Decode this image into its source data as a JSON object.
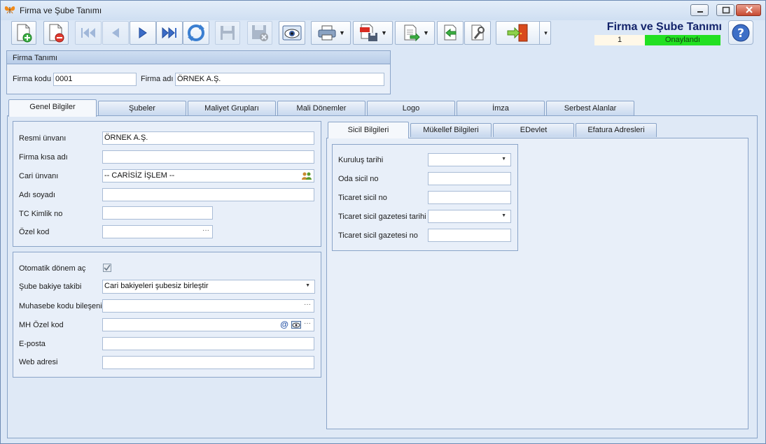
{
  "window": {
    "title": "Firma ve Şube Tanımı"
  },
  "header": {
    "title": "Firma ve Şube Tanımı",
    "record_number": "1",
    "status": "Onaylandı",
    "status_color": "#22e022",
    "brand_color": "#14246b"
  },
  "toolbar": {
    "buttons": [
      {
        "name": "new-record-icon",
        "disabled": false
      },
      {
        "name": "delete-record-icon",
        "disabled": false
      },
      {
        "name": "first-record-icon",
        "disabled": true
      },
      {
        "name": "previous-record-icon",
        "disabled": true
      },
      {
        "name": "next-record-icon",
        "disabled": false
      },
      {
        "name": "last-record-icon",
        "disabled": false
      },
      {
        "name": "refresh-icon",
        "disabled": false
      },
      {
        "name": "save-icon",
        "disabled": true
      },
      {
        "name": "save-cancel-icon",
        "disabled": true
      },
      {
        "name": "preview-icon",
        "disabled": false
      },
      {
        "name": "print-icon",
        "disabled": false
      },
      {
        "name": "pdf-export-icon",
        "disabled": false
      },
      {
        "name": "export-icon",
        "disabled": false
      },
      {
        "name": "import-icon",
        "disabled": false
      },
      {
        "name": "settings-icon",
        "disabled": false
      },
      {
        "name": "exit-icon",
        "disabled": false
      }
    ]
  },
  "firma_tanimi": {
    "title": "Firma Tanımı",
    "firma_kodu_label": "Firma kodu",
    "firma_kodu_value": "0001",
    "firma_adi_label": "Firma adı",
    "firma_adi_value": "ÖRNEK A.Ş."
  },
  "main_tabs": [
    {
      "label": "Genel Bilgiler",
      "active": true
    },
    {
      "label": "Şubeler",
      "active": false
    },
    {
      "label": "Maliyet Grupları",
      "active": false
    },
    {
      "label": "Mali Dönemler",
      "active": false
    },
    {
      "label": "Logo",
      "active": false
    },
    {
      "label": "İmza",
      "active": false
    },
    {
      "label": "Serbest Alanlar",
      "active": false
    }
  ],
  "genel": {
    "resmi_unvani_label": "Resmi ünvanı",
    "resmi_unvani_value": "ÖRNEK A.Ş.",
    "firma_kisa_adi_label": "Firma kısa adı",
    "firma_kisa_adi_value": "",
    "cari_unvani_label": "Cari ünvanı",
    "cari_unvani_value": "-- CARİSİZ İŞLEM --",
    "adi_soyadi_label": "Adı soyadı",
    "adi_soyadi_value": "",
    "tc_kimlik_label": "TC Kimlik no",
    "tc_kimlik_value": "",
    "ozel_kod_label": "Özel kod",
    "ozel_kod_value": "",
    "ellipsis": "···"
  },
  "ayarlar": {
    "otomatik_donem_label": "Otomatik dönem aç",
    "otomatik_donem_checked": true,
    "sube_bakiye_label": "Şube bakiye takibi",
    "sube_bakiye_value": "Cari bakiyeleri şubesiz birleştir",
    "muhasebe_kodu_label": "Muhasebe kodu bileşeni",
    "muhasebe_kodu_value": "",
    "mh_ozel_kod_label": "MH Özel kod",
    "mh_ozel_kod_value": "",
    "at_symbol": "@",
    "eposta_label": "E-posta",
    "eposta_value": "",
    "web_label": "Web adresi",
    "web_value": ""
  },
  "sub_tabs": [
    {
      "label": "Sicil Bilgileri",
      "active": true
    },
    {
      "label": "Mükellef Bilgileri",
      "active": false
    },
    {
      "label": "EDevlet",
      "active": false
    },
    {
      "label": "Efatura Adresleri",
      "active": false
    }
  ],
  "sicil": {
    "kurulus_tarihi_label": "Kuruluş tarihi",
    "kurulus_tarihi_value": "",
    "oda_sicil_label": "Oda sicil no",
    "oda_sicil_value": "",
    "ticaret_sicil_label": "Ticaret sicil no",
    "ticaret_sicil_value": "",
    "gazete_tarihi_label": "Ticaret sicil gazetesi tarihi",
    "gazete_tarihi_value": "",
    "gazete_no_label": "Ticaret sicil gazetesi no",
    "gazete_no_value": ""
  }
}
